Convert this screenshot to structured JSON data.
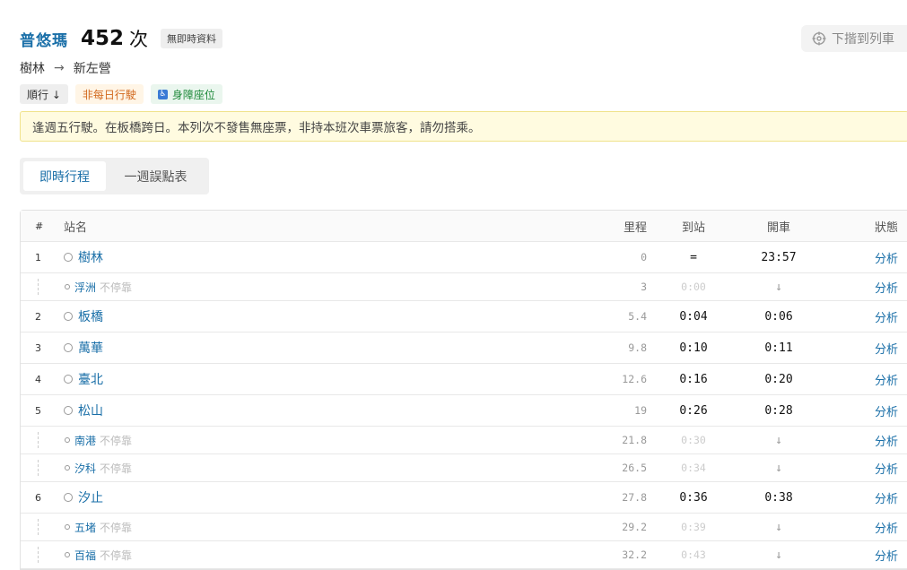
{
  "train": {
    "type": "普悠瑪",
    "number": "452",
    "suffix": "次",
    "realtime_badge": "無即時資料",
    "follow_label": "下揩到列車",
    "from": "樹林",
    "arrow": "→",
    "to": "新左營"
  },
  "tags": {
    "direction": "順行 ↓",
    "non_daily": "非每日行駛",
    "accessible": "身障座位"
  },
  "notice": "逢週五行駛。在板橋跨日。本列次不發售無座票，非持本班次車票旅客，請勿搭乘。",
  "tabs": [
    "即時行程",
    "一週誤點表"
  ],
  "table": {
    "headers": {
      "idx": "#",
      "name": "站名",
      "mileage": "里程",
      "arrive": "到站",
      "depart": "開車",
      "status": "狀態"
    },
    "rows": [
      {
        "kind": "major",
        "idx": "1",
        "name": "樹林",
        "mileage": "0",
        "arrive": "=",
        "depart": "23:57",
        "status": "分析"
      },
      {
        "kind": "minor",
        "name": "浮洲",
        "note": "不停靠",
        "mileage": "3",
        "arrive": "0:00",
        "depart": "↓",
        "status": "分析"
      },
      {
        "kind": "major",
        "idx": "2",
        "name": "板橋",
        "mileage": "5.4",
        "arrive": "0:04",
        "depart": "0:06",
        "status": "分析"
      },
      {
        "kind": "major",
        "idx": "3",
        "name": "萬華",
        "mileage": "9.8",
        "arrive": "0:10",
        "depart": "0:11",
        "status": "分析"
      },
      {
        "kind": "major",
        "idx": "4",
        "name": "臺北",
        "mileage": "12.6",
        "arrive": "0:16",
        "depart": "0:20",
        "status": "分析"
      },
      {
        "kind": "major",
        "idx": "5",
        "name": "松山",
        "mileage": "19",
        "arrive": "0:26",
        "depart": "0:28",
        "status": "分析"
      },
      {
        "kind": "minor",
        "name": "南港",
        "note": "不停靠",
        "mileage": "21.8",
        "arrive": "0:30",
        "depart": "↓",
        "status": "分析"
      },
      {
        "kind": "minor",
        "name": "汐科",
        "note": "不停靠",
        "mileage": "26.5",
        "arrive": "0:34",
        "depart": "↓",
        "status": "分析"
      },
      {
        "kind": "major",
        "idx": "6",
        "name": "汐止",
        "mileage": "27.8",
        "arrive": "0:36",
        "depart": "0:38",
        "status": "分析"
      },
      {
        "kind": "minor",
        "name": "五堵",
        "note": "不停靠",
        "mileage": "29.2",
        "arrive": "0:39",
        "depart": "↓",
        "status": "分析"
      },
      {
        "kind": "minor",
        "name": "百福",
        "note": "不停靠",
        "mileage": "32.2",
        "arrive": "0:43",
        "depart": "↓",
        "status": "分析"
      }
    ]
  }
}
